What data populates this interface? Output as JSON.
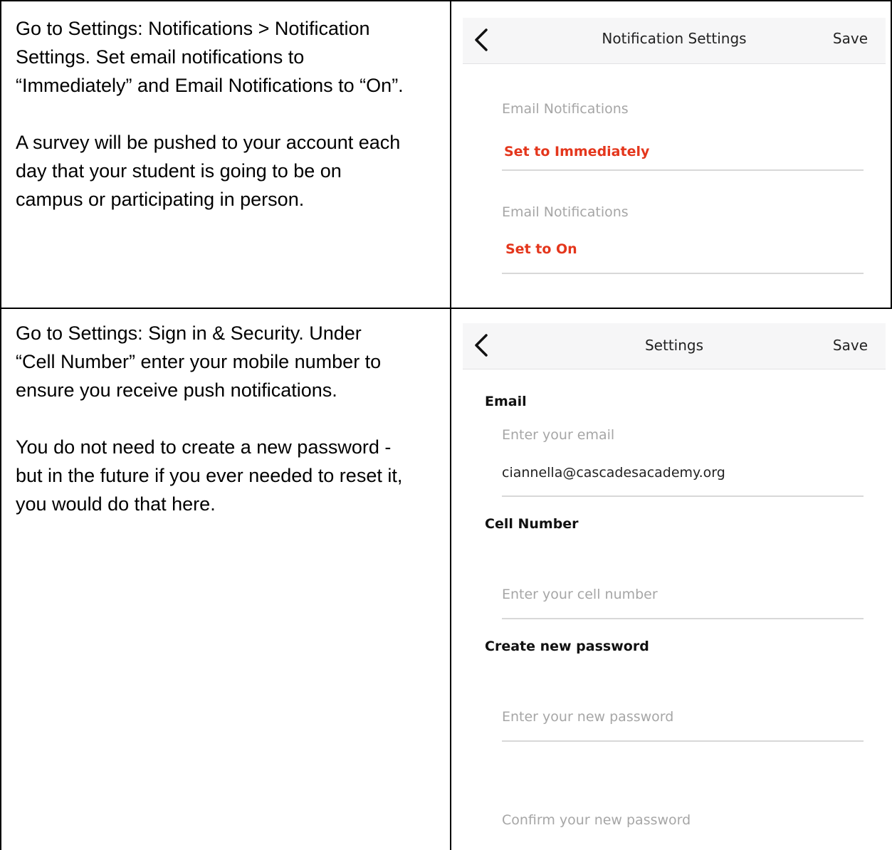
{
  "row1": {
    "instructions": "Go to Settings: Notifications > Notification\nSettings. Set email notifications to\n“Immediately” and Email Notifications to “On”.\n\nA survey will be pushed to your account each\nday that your student is going to be on\ncampus or participating in person.",
    "screen": {
      "title": "Notification Settings",
      "save_label": "Save",
      "fields": [
        {
          "label": "Email Notifications",
          "value": "Set to Immediately"
        },
        {
          "label": "Email Notifications",
          "value": "Set to On"
        }
      ]
    }
  },
  "row2": {
    "instructions": "Go to Settings: Sign in & Security.  Under\n“Cell Number” enter your mobile number to\nensure you receive push notifications.\n\nYou do not  need to create a new password -\nbut in the future if you ever needed to reset it,\nyou would do that here.",
    "screen": {
      "title": "Settings",
      "save_label": "Save",
      "email": {
        "heading": "Email",
        "placeholder": "Enter your email",
        "value": "ciannella@cascadesacademy.org"
      },
      "cell": {
        "heading": "Cell Number",
        "placeholder": "Enter your cell number"
      },
      "password": {
        "heading": "Create new password",
        "new_placeholder": "Enter your new password",
        "confirm_placeholder": "Confirm your new password"
      }
    }
  },
  "colors": {
    "accent_red": "#e4361c",
    "placeholder_grey": "#a6a6a6",
    "navbar_bg": "#f6f6f7"
  },
  "icons": [
    "back-chevron-icon"
  ]
}
